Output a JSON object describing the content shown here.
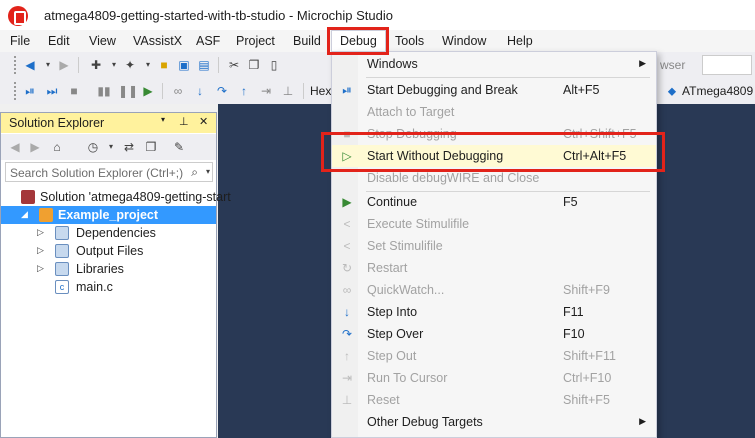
{
  "window": {
    "title": "atmega4809-getting-started-with-tb-studio - Microchip Studio"
  },
  "menubar": {
    "items": [
      {
        "label": "File"
      },
      {
        "label": "Edit"
      },
      {
        "label": "View"
      },
      {
        "label": "VAssistX"
      },
      {
        "label": "ASF"
      },
      {
        "label": "Project"
      },
      {
        "label": "Build"
      },
      {
        "label": "Debug"
      },
      {
        "label": "Tools"
      },
      {
        "label": "Window"
      },
      {
        "label": "Help"
      }
    ]
  },
  "toolbar": {
    "hex_label": "Hex",
    "browser_label": "wser",
    "device_label": "ATmega4809"
  },
  "solution_explorer": {
    "title": "Solution Explorer",
    "search_placeholder": "Search Solution Explorer (Ctrl+;)",
    "tree": [
      {
        "label": "Solution 'atmega4809-getting-start"
      },
      {
        "label": "Example_project"
      },
      {
        "label": "Dependencies"
      },
      {
        "label": "Output Files"
      },
      {
        "label": "Libraries"
      },
      {
        "label": "main.c"
      }
    ]
  },
  "debug_menu": {
    "items": [
      {
        "label": "Windows",
        "shortcut": "",
        "icon": "none",
        "enabled": true,
        "submenu": true
      },
      {
        "label": "Start Debugging and Break",
        "shortcut": "Alt+F5",
        "icon": "debug-break-icon",
        "enabled": true
      },
      {
        "label": "Attach to Target",
        "shortcut": "",
        "icon": "none",
        "enabled": false
      },
      {
        "label": "Stop Debugging",
        "shortcut": "Ctrl+Shift+F5",
        "icon": "stop-icon",
        "enabled": false
      },
      {
        "label": "Start Without Debugging",
        "shortcut": "Ctrl+Alt+F5",
        "icon": "play-outline-icon",
        "enabled": true,
        "highlighted": true
      },
      {
        "label": "Disable debugWIRE and Close",
        "shortcut": "",
        "icon": "none",
        "enabled": false
      },
      {
        "label": "Continue",
        "shortcut": "F5",
        "icon": "play-icon",
        "enabled": true
      },
      {
        "label": "Execute Stimulifile",
        "shortcut": "",
        "icon": "stimuli-icon",
        "enabled": false
      },
      {
        "label": "Set Stimulifile",
        "shortcut": "",
        "icon": "stimuli-icon",
        "enabled": false
      },
      {
        "label": "Restart",
        "shortcut": "",
        "icon": "restart-icon",
        "enabled": false
      },
      {
        "label": "QuickWatch...",
        "shortcut": "Shift+F9",
        "icon": "glasses-icon",
        "enabled": false
      },
      {
        "label": "Step Into",
        "shortcut": "F11",
        "icon": "step-into-icon",
        "enabled": true
      },
      {
        "label": "Step Over",
        "shortcut": "F10",
        "icon": "step-over-icon",
        "enabled": true
      },
      {
        "label": "Step Out",
        "shortcut": "Shift+F11",
        "icon": "step-out-icon",
        "enabled": false
      },
      {
        "label": "Run To Cursor",
        "shortcut": "Ctrl+F10",
        "icon": "run-to-cursor-icon",
        "enabled": false
      },
      {
        "label": "Reset",
        "shortcut": "Shift+F5",
        "icon": "reset-icon",
        "enabled": false
      },
      {
        "label": "Other Debug Targets",
        "shortcut": "",
        "icon": "none",
        "enabled": true,
        "submenu": true
      }
    ]
  },
  "colors": {
    "accent_red": "#e2231a",
    "selection_blue": "#3399ff",
    "panel_header_yellow": "#fff29d",
    "editor_background": "#293955"
  }
}
